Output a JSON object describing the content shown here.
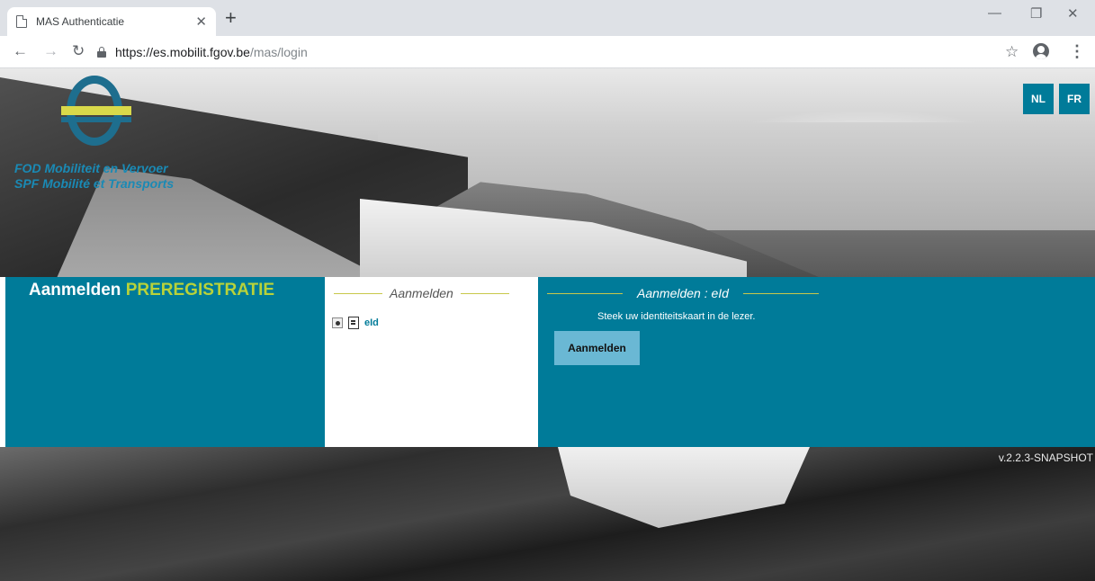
{
  "browser": {
    "tab_title": "MAS Authenticatie",
    "url_host": "https://es.mobilit.fgov.be",
    "url_path": "/mas/login"
  },
  "icons": {
    "tab_page": "document-icon",
    "tab_close": "close-icon",
    "new_tab": "plus-icon",
    "minimize": "minimize-icon",
    "restore": "restore-icon",
    "close_window": "close-icon",
    "back": "back-arrow-icon",
    "forward": "forward-arrow-icon",
    "reload": "reload-icon",
    "secure": "lock-icon",
    "bookmark": "star-icon",
    "account": "account-icon",
    "menu": "kebab-menu-icon",
    "eid": "id-card-icon"
  },
  "header": {
    "logo_line1": "FOD Mobiliteit en Vervoer",
    "logo_line2": "SPF Mobilité et Transports",
    "lang_nl": "NL",
    "lang_fr": "FR"
  },
  "panel": {
    "title": "Aanmelden",
    "title_accent": "PREREGISTRATIE",
    "methods_legend": "Aanmelden",
    "methods": [
      {
        "label": "eId",
        "selected": true
      }
    ],
    "login_legend": "Aanmelden : eId",
    "instruction": "Steek uw identiteitskaart in de lezer.",
    "submit_label": "Aanmelden"
  },
  "footer": {
    "version": "v.2.2.3-SNAPSHOT"
  },
  "colors": {
    "brand": "#007b99",
    "accent": "#b8d23a",
    "button": "#6ab8d4"
  }
}
